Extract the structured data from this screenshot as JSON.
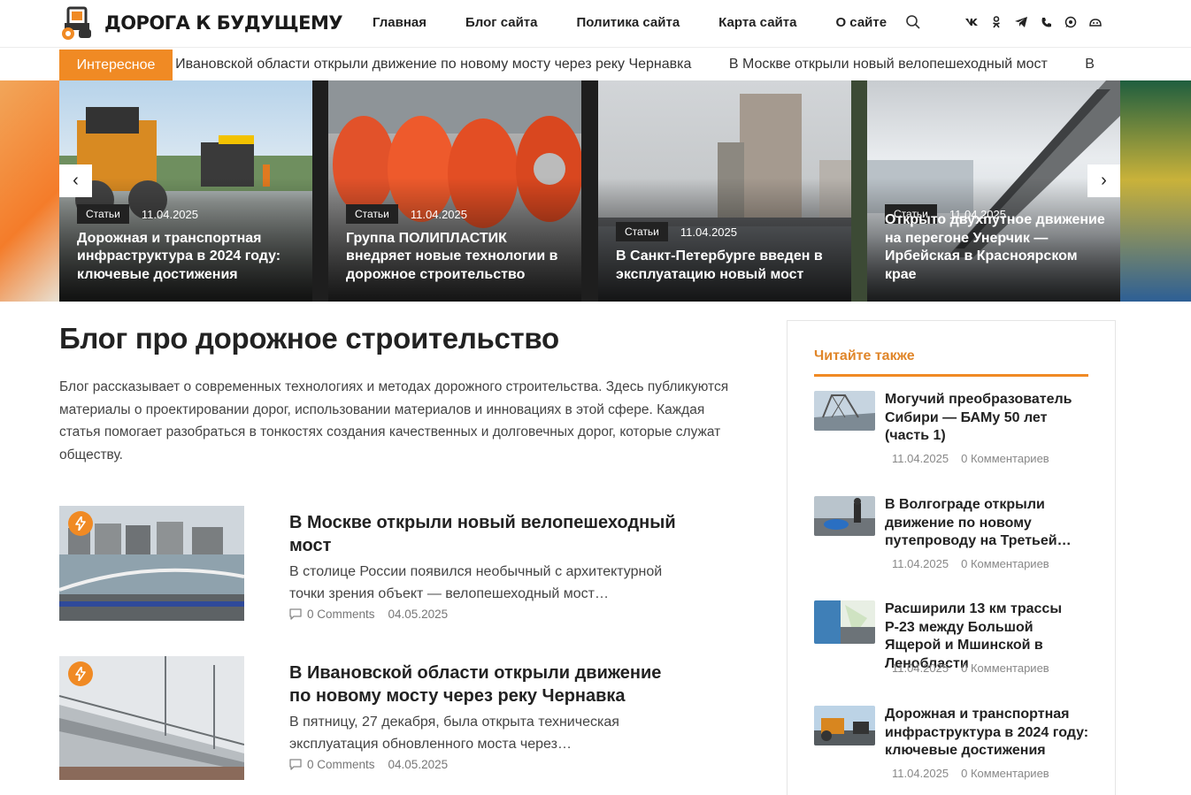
{
  "site": {
    "name": "ДОРОГА К БУДУЩЕМУ"
  },
  "nav": [
    {
      "label": "Главная"
    },
    {
      "label": "Блог сайта"
    },
    {
      "label": "Политика сайта"
    },
    {
      "label": "Карта сайта"
    },
    {
      "label": "О сайте"
    }
  ],
  "icons": {
    "search": "search-icon",
    "social": [
      "vk-icon",
      "ok-icon",
      "telegram-icon",
      "viber-icon",
      "whatsapp-icon",
      "vk-messenger-icon"
    ]
  },
  "ticker": {
    "label": "Интересное",
    "items": [
      "В Ивановской области открыли движение по новому мосту через реку Чернавка",
      "В Москве открыли новый велопешеходный мост",
      "В"
    ]
  },
  "slider": {
    "slides": [
      {
        "category": "Статьи",
        "date": "11.04.2025",
        "title": "Дорожная и транспортная инфраструктура в 2024 году: ключевые достижения"
      },
      {
        "category": "Статьи",
        "date": "11.04.2025",
        "title": "Группа ПОЛИПЛАСТИК внедряет новые технологии в дорожное строительство"
      },
      {
        "category": "Статьи",
        "date": "11.04.2025",
        "title": "В Санкт-Петербурге введен в эксплуатацию новый мост"
      },
      {
        "category": "Статьи",
        "date": "11.04.2025",
        "title": "Открыто двухпутное движение на перегоне Унерчик — Ирбейская в Красноярском крае"
      }
    ],
    "prev": "‹",
    "next": "›"
  },
  "main": {
    "title": "Блог про дорожное строительство",
    "description": "Блог рассказывает о современных технологиях и методах дорожного строительства. Здесь публикуются материалы о проектировании дорог, использовании материалов и инновациях в этой сфере. Каждая статья помогает разобраться в тонкостях создания качественных и долговечных дорог, которые служат обществу.",
    "posts": [
      {
        "title": "В Москве открыли новый велопешеходный мост",
        "excerpt": "В столице России появился необычный с архитектурной точки зрения объект — велопешеходный мост…",
        "comments": "0 Comments",
        "date": "04.05.2025"
      },
      {
        "title": "В Ивановской области открыли движение по новому мосту через реку Чернавка",
        "excerpt": "В пятницу, 27 декабря, была открыта техническая эксплуатация обновленного моста через…",
        "comments": "0 Comments",
        "date": "04.05.2025"
      }
    ]
  },
  "sidebar": {
    "title": "Читайте также",
    "items": [
      {
        "title": "Могучий преобразователь Сибири — БАМу 50 лет (часть 1)",
        "date": "11.04.2025",
        "comments": "0 Комментариев"
      },
      {
        "title": "В Волгограде открыли движение по новому путепроводу на Третьей…",
        "date": "11.04.2025",
        "comments": "0 Комментариев"
      },
      {
        "title": "Расширили 13 км трассы Р-23 между Большой Ящерой и Мшинской в Ленобласти",
        "date": "11.04.2025",
        "comments": "0 Комментариев"
      },
      {
        "title": "Дорожная и транспортная инфраструктура в 2024 году: ключевые достижения",
        "date": "11.04.2025",
        "comments": "0 Комментариев"
      }
    ]
  },
  "colors": {
    "accent": "#f08a24",
    "text": "#222222"
  }
}
